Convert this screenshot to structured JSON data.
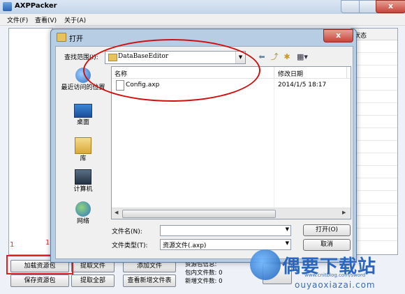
{
  "main": {
    "title": "AXPPacker",
    "close_label": "x",
    "menu": [
      "文件(F)",
      "查看(V)",
      "关于(A)"
    ],
    "grid_header": "状态",
    "buttons": {
      "load_package": "加载资源包",
      "extract_file": "提取文件",
      "add_file": "添加文件",
      "save_package": "保存资源包",
      "extract_all": "提取全部",
      "view_added": "查看新增文件表"
    },
    "info": {
      "package_info": "资源包信息:",
      "file_count": "包内文件数: 0",
      "added_count": "新增文件数: 0"
    },
    "annotations": {
      "num1": "1",
      "num2": "1"
    }
  },
  "dialog": {
    "title": "打开",
    "close_label": "x",
    "lookin_label": "查找范围(I):",
    "lookin_value": "DataBaseEditor",
    "places": [
      "最近访问的位置",
      "桌面",
      "库",
      "计算机",
      "网络"
    ],
    "columns": {
      "name": "名称",
      "date": "修改日期"
    },
    "files": [
      {
        "name": "Config.axp",
        "date": "2014/1/5 18:17"
      }
    ],
    "filename_label": "文件名(N):",
    "filename_value": "",
    "filetype_label": "文件类型(T):",
    "filetype_value": "资源文件(.axp)",
    "open_button": "打开(O)",
    "cancel_button": "取消"
  },
  "watermark": {
    "title": "偶要下载站",
    "url_small": "www.cnitblog.com/sword",
    "url_big": "ouyaoxiazai.com"
  },
  "colors": {
    "highlight_red": "#e02020",
    "title_bg": "#c3d4e9",
    "dialog_bg": "#b6cde4"
  }
}
